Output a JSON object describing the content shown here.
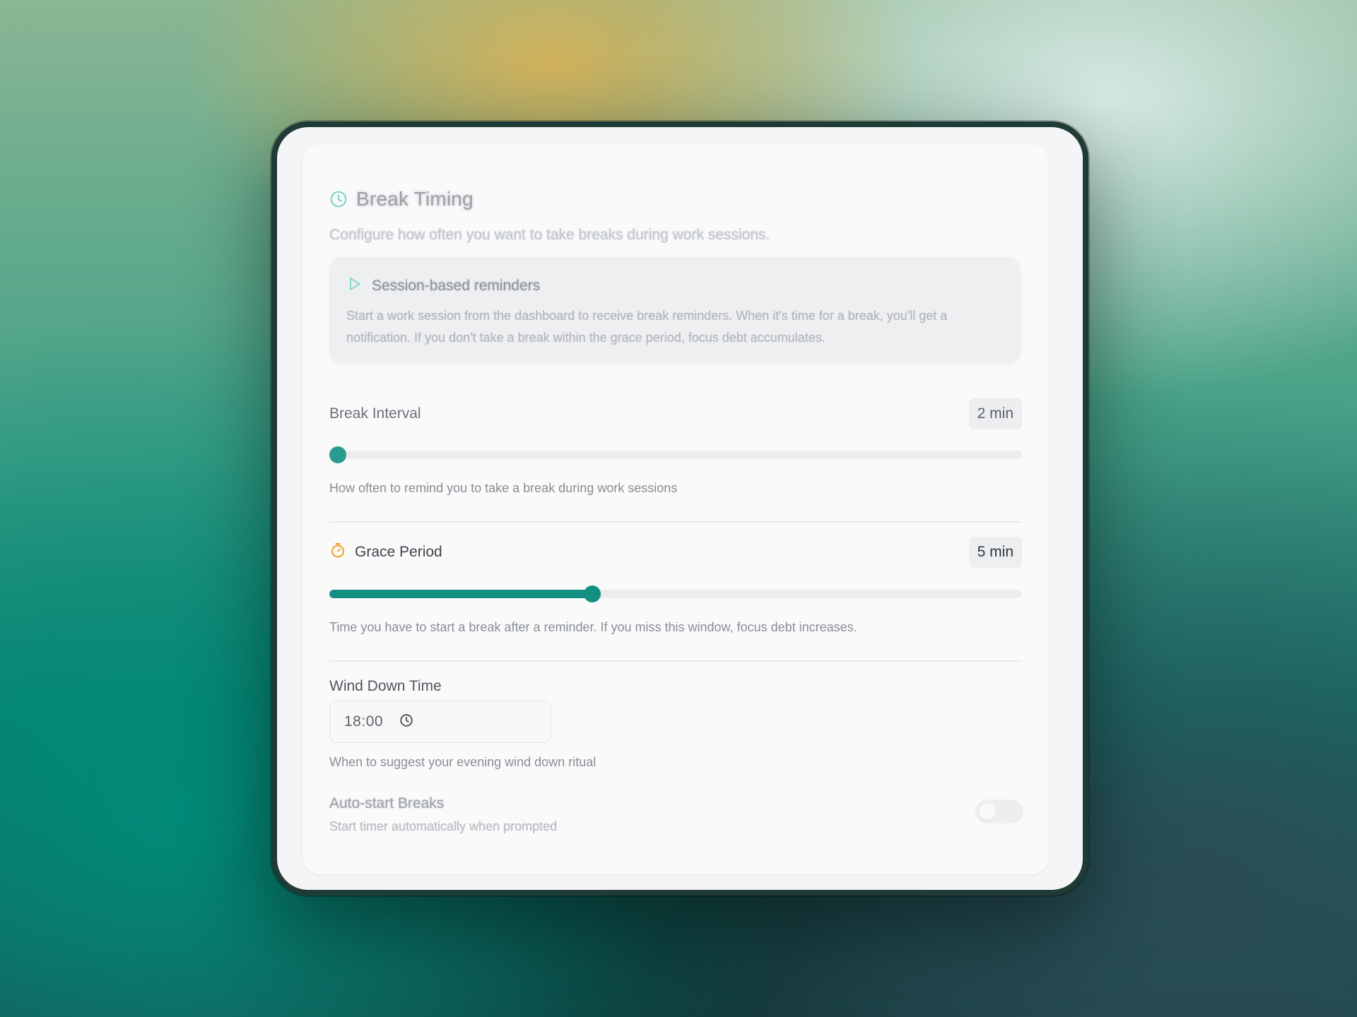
{
  "section": {
    "title": "Break Timing",
    "subtitle": "Configure how often you want to take breaks during work sessions."
  },
  "info": {
    "title": "Session-based reminders",
    "text": "Start a work session from the dashboard to receive break reminders. When it's time for a break, you'll get a notification. If you don't take a break within the grace period, focus debt accumulates."
  },
  "break_interval": {
    "label": "Break Interval",
    "value_display": "2 min",
    "slider_fraction": 0.0,
    "help": "How often to remind you to take a break during work sessions"
  },
  "grace_period": {
    "label": "Grace Period",
    "value_display": "5 min",
    "slider_fraction": 0.38,
    "help": "Time you have to start a break after a reminder. If you miss this window, focus debt increases."
  },
  "wind_down": {
    "label": "Wind Down Time",
    "value": "18:00",
    "help": "When to suggest your evening wind down ritual"
  },
  "auto_start": {
    "label": "Auto-start Breaks",
    "description": "Start timer automatically when prompted",
    "enabled": false
  },
  "colors": {
    "accent": "#138f82",
    "timer_icon": "#f0a020",
    "clock_icon": "#7fd3c6"
  },
  "icons": {
    "section": "clock-icon",
    "info": "play-icon",
    "grace": "timer-icon",
    "time_input": "clock-icon"
  }
}
